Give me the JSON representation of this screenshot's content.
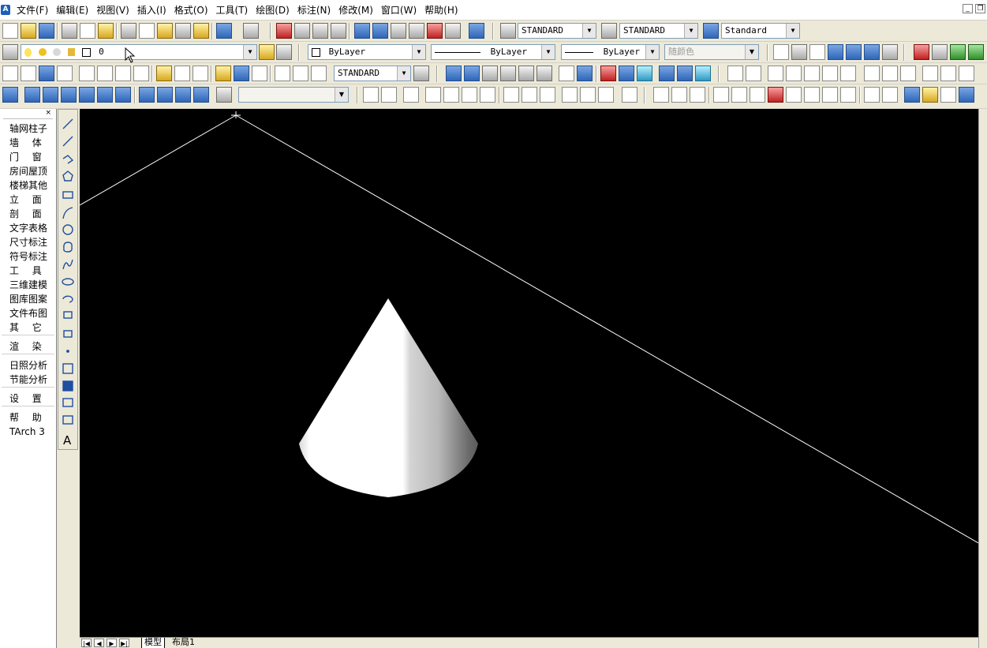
{
  "menu": {
    "items": [
      "文件(F)",
      "编辑(E)",
      "视图(V)",
      "插入(I)",
      "格式(O)",
      "工具(T)",
      "绘图(D)",
      "标注(N)",
      "修改(M)",
      "窗口(W)",
      "帮助(H)"
    ]
  },
  "window_controls": {
    "minimize": "_",
    "restore": "❐"
  },
  "toolbar": {
    "text_style": "STANDARD",
    "dim_style": "STANDARD",
    "table_style": "Standard",
    "layer": "0",
    "color": "ByLayer",
    "linetype": "ByLayer",
    "lineweight": "ByLayer",
    "plot_style": "随颜色",
    "dim_style_2": "STANDARD",
    "view_combo": ""
  },
  "tarch": {
    "items": [
      "轴网柱子",
      "墙体",
      "门窗",
      "房间屋顶",
      "楼梯其他",
      "立面",
      "剖面",
      "文字表格",
      "尺寸标注",
      "符号标注",
      "工具",
      "三维建模",
      "图库图案",
      "文件布图",
      "其它"
    ],
    "group2": [
      "渲染"
    ],
    "group3": [
      "日照分析",
      "节能分析"
    ],
    "group4": [
      "设置"
    ],
    "group5": [
      "帮助",
      "TArch 3"
    ]
  },
  "tabs": {
    "model": "模型",
    "layout1": "布局1"
  },
  "nav": {
    "first": "|◀",
    "prev": "◀",
    "next": "▶",
    "last": "▶|"
  },
  "colors": {
    "canvas": "#000000",
    "cone": "#ffffff",
    "lines": "#ffffff"
  }
}
